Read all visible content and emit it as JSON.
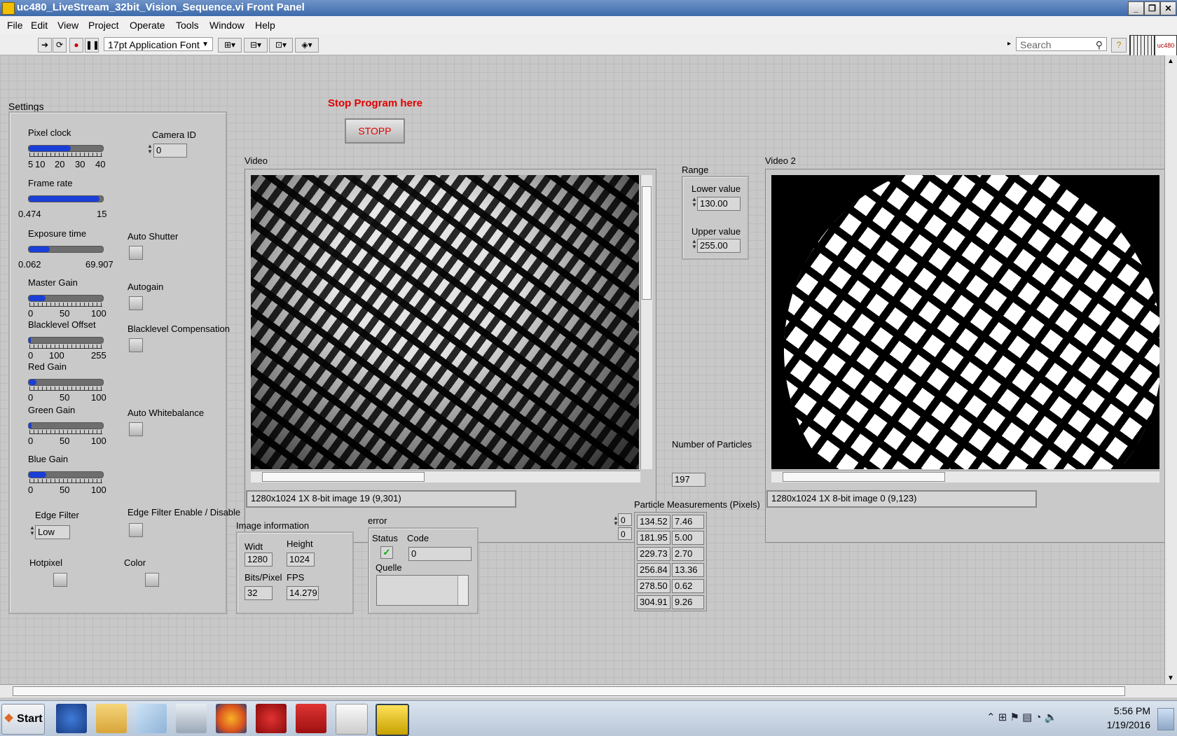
{
  "window": {
    "title": "uc480_LiveStream_32bit_Vision_Sequence.vi Front Panel"
  },
  "menu": [
    "File",
    "Edit",
    "View",
    "Project",
    "Operate",
    "Tools",
    "Window",
    "Help"
  ],
  "toolbar": {
    "font": "17pt Application Font",
    "search_placeholder": "Search",
    "logo": "uc480"
  },
  "settings": {
    "title": "Settings",
    "pixel_clock": {
      "label": "Pixel clock",
      "ticks": [
        "5",
        "10",
        "20",
        "30",
        "40"
      ],
      "value_fraction": 0.57
    },
    "frame_rate": {
      "label": "Frame rate",
      "min": "0.474",
      "max": "15",
      "value_fraction": 0.95
    },
    "exposure_time": {
      "label": "Exposure time",
      "min": "0.062",
      "max": "69.907",
      "value_fraction": 0.28
    },
    "master_gain": {
      "label": "Master Gain",
      "ticks": [
        "0",
        "50",
        "100"
      ],
      "value_fraction": 0.23
    },
    "blacklevel_offset": {
      "label": "Blacklevel Offset",
      "ticks": [
        "0",
        "100",
        "255"
      ],
      "value_fraction": 0.03
    },
    "red_gain": {
      "label": "Red Gain",
      "ticks": [
        "0",
        "50",
        "100"
      ],
      "value_fraction": 0.1
    },
    "green_gain": {
      "label": "Green Gain",
      "ticks": [
        "0",
        "50",
        "100"
      ],
      "value_fraction": 0.04
    },
    "blue_gain": {
      "label": "Blue Gain",
      "ticks": [
        "0",
        "50",
        "100"
      ],
      "value_fraction": 0.24
    },
    "camera_id": {
      "label": "Camera ID",
      "value": "0"
    },
    "auto_shutter": "Auto Shutter",
    "autogain": "Autogain",
    "blacklevel_compensation": "Blacklevel Compensation",
    "auto_whitebalance": "Auto Whitebalance",
    "edge_filter": {
      "label": "Edge Filter",
      "value": "Low"
    },
    "edge_filter_enable": "Edge Filter Enable / Disable",
    "hotpixel": "Hotpixel",
    "color": "Color"
  },
  "stop": {
    "caption": "Stop Program here",
    "button": "STOPP"
  },
  "video1": {
    "label": "Video",
    "status": "1280x1024 1X 8-bit image 19    (9,301)"
  },
  "video2": {
    "label": "Video 2",
    "status": "1280x1024 1X 8-bit image 0    (9,123)"
  },
  "range": {
    "title": "Range",
    "lower_label": "Lower value",
    "lower": "130.00",
    "upper_label": "Upper value",
    "upper": "255.00"
  },
  "particles": {
    "label": "Number of Particles",
    "value": "197"
  },
  "measurements": {
    "label": "Particle Measurements (Pixels)",
    "index": [
      "0",
      "0"
    ],
    "rows": [
      [
        "134.52",
        "7.46"
      ],
      [
        "181.95",
        "5.00"
      ],
      [
        "229.73",
        "2.70"
      ],
      [
        "256.84",
        "13.36"
      ],
      [
        "278.50",
        "0.62"
      ],
      [
        "304.91",
        "9.26"
      ]
    ]
  },
  "image_info": {
    "title": "Image information",
    "width_label": "Widt",
    "width": "1280",
    "height_label": "Height",
    "height": "1024",
    "bits_label": "Bits/Pixel",
    "bits": "32",
    "fps_label": "FPS",
    "fps": "14.279"
  },
  "error": {
    "title": "error",
    "status_label": "Status",
    "code_label": "Code",
    "code": "0",
    "source_label": "Quelle"
  },
  "taskbar": {
    "start": "Start",
    "time": "5:56 PM",
    "date": "1/19/2016"
  }
}
